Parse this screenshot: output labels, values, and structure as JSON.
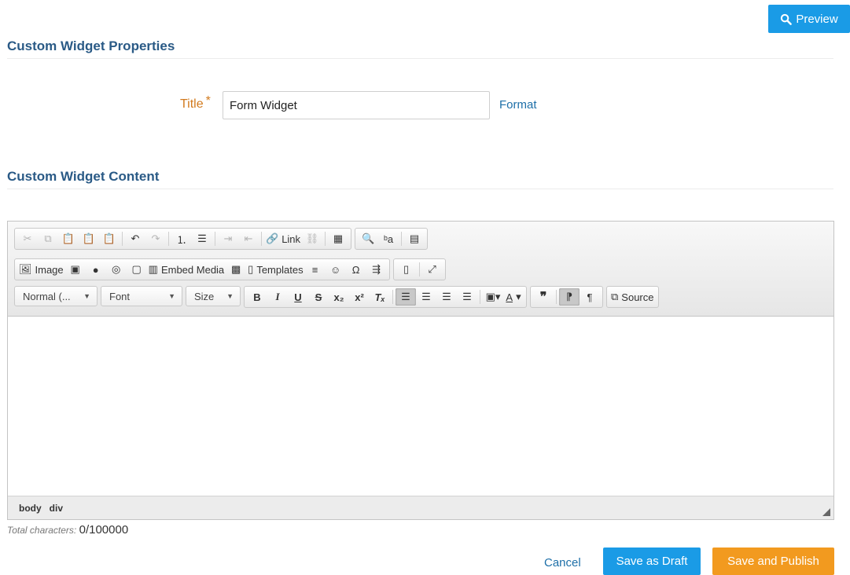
{
  "header": {
    "preview_label": "Preview",
    "properties_title": "Custom Widget Properties",
    "content_title": "Custom Widget Content"
  },
  "form": {
    "title_label": "Title",
    "required_mark": "*",
    "title_value": "Form Widget",
    "format_link": "Format"
  },
  "toolbar": {
    "link_label": "Link",
    "image_label": "Image",
    "embed_media_label": "Embed Media",
    "templates_label": "Templates",
    "format_combo": "Normal (...",
    "font_combo": "Font",
    "size_combo": "Size",
    "bold": "B",
    "italic": "I",
    "underline": "U",
    "strike": "S",
    "source_label": "Source"
  },
  "statusbar": {
    "path": [
      "body",
      "div"
    ]
  },
  "footer": {
    "char_label": "Total characters:",
    "char_value": "0/100000",
    "cancel": "Cancel",
    "save_draft": "Save as Draft",
    "save_publish": "Save and Publish"
  },
  "colors": {
    "primary": "#1a9be6",
    "accent": "#f29a1f",
    "heading": "#2a5a86",
    "label": "#d27a1e"
  }
}
